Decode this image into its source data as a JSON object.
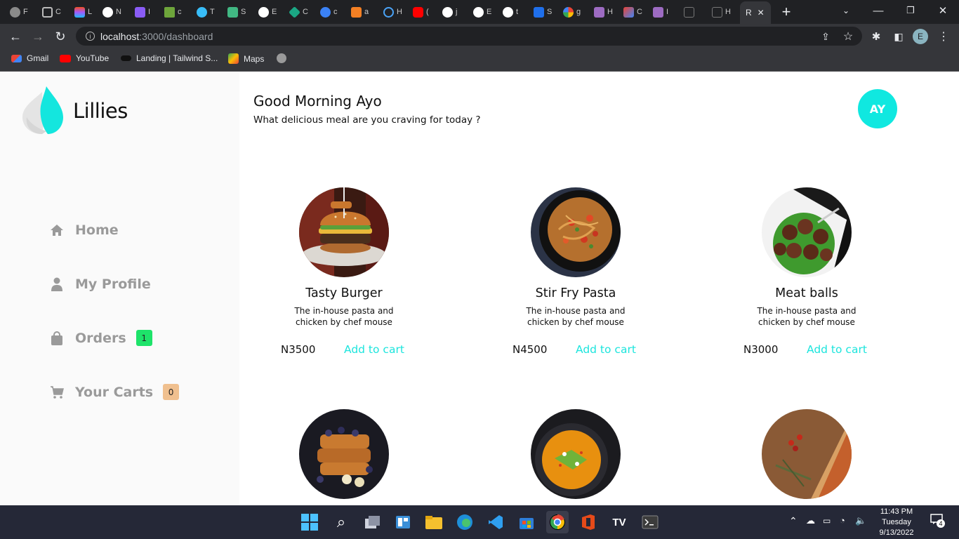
{
  "browser": {
    "active_tab_label": "R",
    "url_host": "localhost",
    "url_path": ":3000/dashboard",
    "bookmarks": [
      {
        "label": "Gmail",
        "icon": "gmail-icon"
      },
      {
        "label": "YouTube",
        "icon": "youtube-icon"
      },
      {
        "label": "Landing | Tailwind S...",
        "icon": "tailwind-icon"
      },
      {
        "label": "Maps",
        "icon": "maps-icon"
      }
    ],
    "profile_initial": "E",
    "tab_letters": [
      "F",
      "C",
      "L",
      "N",
      "I",
      "c",
      "T",
      "S",
      "E",
      "C",
      "c",
      "a",
      "H",
      "(",
      "j",
      "E",
      "t",
      "S",
      "g",
      "H",
      "C",
      "I",
      "",
      "H"
    ]
  },
  "sidebar": {
    "logo_text": "Lillies",
    "nav": [
      {
        "label": "Home",
        "icon": "home-icon"
      },
      {
        "label": "My Profile",
        "icon": "user-icon"
      },
      {
        "label": "Orders",
        "icon": "shopping-bag-icon",
        "badge": "1",
        "badge_color": "#1ee36a"
      },
      {
        "label": "Your Carts",
        "icon": "cart-icon",
        "badge": "0",
        "badge_color": "#f0c08f"
      }
    ]
  },
  "header": {
    "greeting": "Good Morning Ayo",
    "subtitle": "What delicious meal are you craving for today ?",
    "avatar_initials": "AY",
    "accent_color": "#10e8e0"
  },
  "meals": [
    {
      "name": "Tasty Burger",
      "description": "The in-house pasta and chicken by chef mouse",
      "price": "N3500",
      "action": "Add to cart",
      "image": "burger-image"
    },
    {
      "name": "Stir Fry Pasta",
      "description": "The in-house pasta and chicken by chef mouse",
      "price": "N4500",
      "action": "Add to cart",
      "image": "pasta-image"
    },
    {
      "name": "Meat balls",
      "description": "The in-house pasta and chicken by chef mouse",
      "price": "N3000",
      "action": "Add to cart",
      "image": "meatballs-image"
    },
    {
      "image": "french-toast-image"
    },
    {
      "image": "soup-image"
    },
    {
      "image": "pizza-image"
    }
  ],
  "taskbar": {
    "time": "11:43 PM",
    "day": "Tuesday",
    "date": "9/13/2022",
    "notifications": "4"
  }
}
